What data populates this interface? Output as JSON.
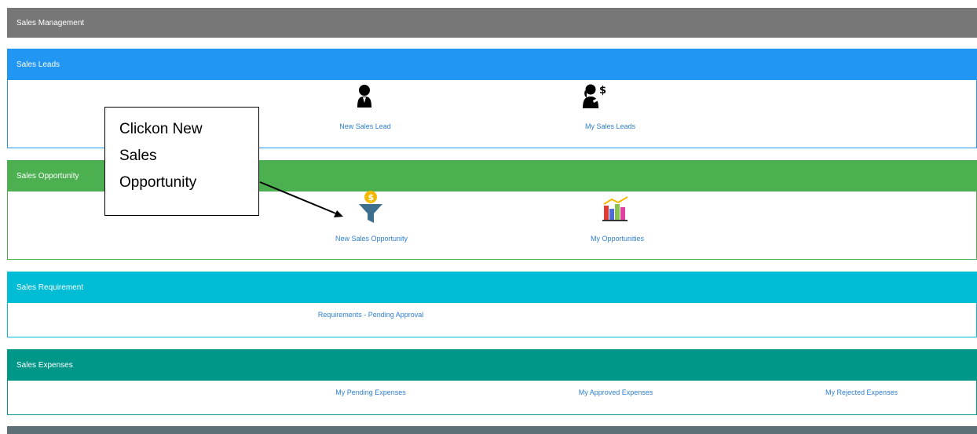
{
  "header": {
    "title": "Sales Management"
  },
  "sections": {
    "leads": {
      "title": "Sales Leads",
      "items": [
        {
          "label": "New Sales Lead",
          "icon": "person-icon"
        },
        {
          "label": "My Sales Leads",
          "icon": "person-dollar-icon"
        }
      ]
    },
    "opportunity": {
      "title": "Sales Opportunity",
      "items": [
        {
          "label": "New Sales Opportunity",
          "icon": "funnel-dollar-icon"
        },
        {
          "label": "My Opportunities",
          "icon": "bar-chart-icon"
        }
      ]
    },
    "requirement": {
      "title": "Sales Requirement",
      "items": [
        {
          "label": "Requirements - Pending Approval"
        }
      ]
    },
    "expenses": {
      "title": "Sales Expenses",
      "items": [
        {
          "label": "My Pending Expenses"
        },
        {
          "label": "My Approved Expenses"
        },
        {
          "label": "My Rejected Expenses"
        }
      ]
    }
  },
  "callout": {
    "lines": [
      "Clickon New",
      "Sales",
      "Opportunity"
    ]
  },
  "colors": {
    "header": "#777777",
    "leads": "#2196f3",
    "opportunity": "#4caf50",
    "requirement": "#00bcd4",
    "expenses": "#009688",
    "footer": "#5f6f78",
    "link": "#2f7fd0"
  }
}
